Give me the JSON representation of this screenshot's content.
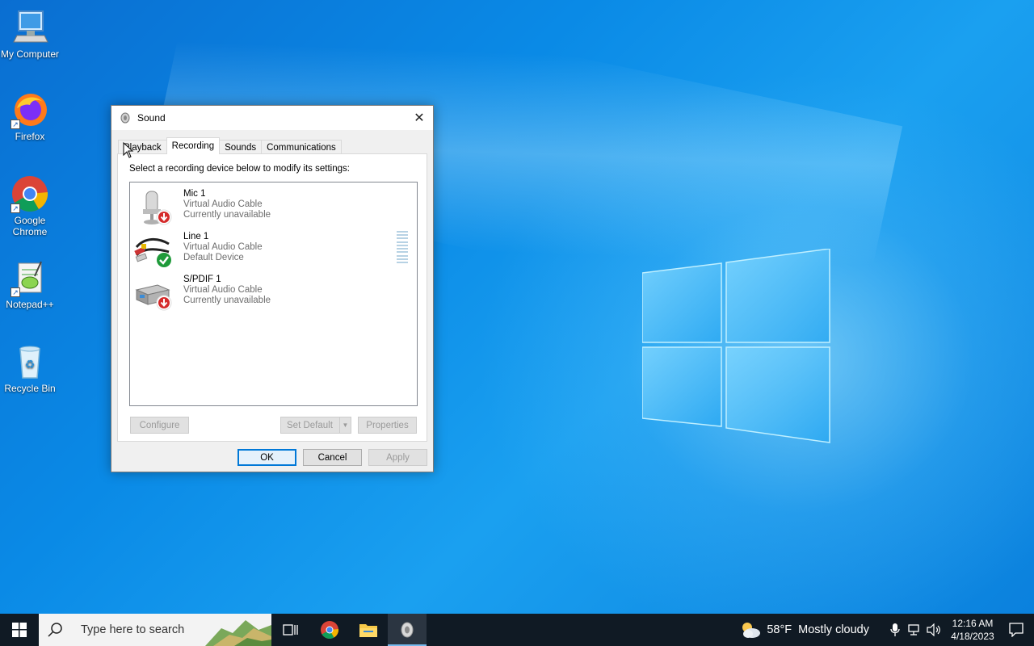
{
  "desktop": {
    "icons": [
      {
        "label": "My Computer"
      },
      {
        "label": "Firefox"
      },
      {
        "label": "Google Chrome"
      },
      {
        "label": "Notepad++"
      },
      {
        "label": "Recycle Bin"
      }
    ]
  },
  "dialog": {
    "title": "Sound",
    "tabs": [
      {
        "label": "Playback",
        "active": false
      },
      {
        "label": "Recording",
        "active": true
      },
      {
        "label": "Sounds",
        "active": false
      },
      {
        "label": "Communications",
        "active": false
      }
    ],
    "instruction": "Select a recording device below to modify its settings:",
    "devices": [
      {
        "name": "Mic 1",
        "description": "Virtual Audio Cable",
        "status": "Currently unavailable",
        "icon": "microphone-icon",
        "badge": "unavailable-arrow-icon"
      },
      {
        "name": "Line 1",
        "description": "Virtual Audio Cable",
        "status": "Default Device",
        "icon": "line-in-cable-icon",
        "badge": "default-check-icon"
      },
      {
        "name": "S/PDIF 1",
        "description": "Virtual Audio Cable",
        "status": "Currently unavailable",
        "icon": "spdif-device-icon",
        "badge": "unavailable-arrow-icon"
      }
    ],
    "buttons": {
      "configure": "Configure",
      "set_default": "Set Default",
      "properties": "Properties",
      "ok": "OK",
      "cancel": "Cancel",
      "apply": "Apply"
    }
  },
  "taskbar": {
    "search_placeholder": "Type here to search",
    "weather": {
      "temp": "58°F",
      "condition": "Mostly cloudy"
    },
    "clock": {
      "time": "12:16 AM",
      "date": "4/18/2023"
    }
  },
  "colors": {
    "accent": "#0078d7",
    "desktop_blue": "#0a8ae6",
    "taskbar": "#101a24"
  }
}
